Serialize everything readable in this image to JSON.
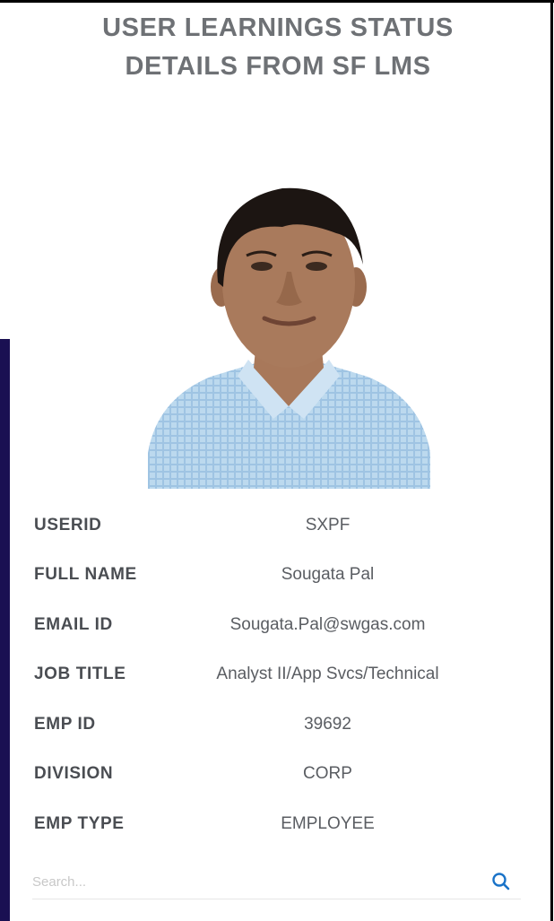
{
  "header": {
    "title_line1": "USER LEARNINGS STATUS",
    "title_line2": "DETAILS FROM SF LMS"
  },
  "profile": {
    "fields": [
      {
        "label": "USERID",
        "value": "SXPF"
      },
      {
        "label": "FULL NAME",
        "value": "Sougata Pal"
      },
      {
        "label": "EMAIL ID",
        "value": "Sougata.Pal@swgas.com"
      },
      {
        "label": "JOB TITLE",
        "value": "Analyst II/App Svcs/Technical"
      },
      {
        "label": "EMP ID",
        "value": "39692"
      },
      {
        "label": "DIVISION",
        "value": "CORP"
      },
      {
        "label": "EMP TYPE",
        "value": "EMPLOYEE"
      }
    ]
  },
  "search": {
    "placeholder": "Search...",
    "icon": "search-icon",
    "icon_color": "#1a73c8"
  },
  "colors": {
    "side_band": "#1a1052",
    "title_text": "#6e7175"
  }
}
